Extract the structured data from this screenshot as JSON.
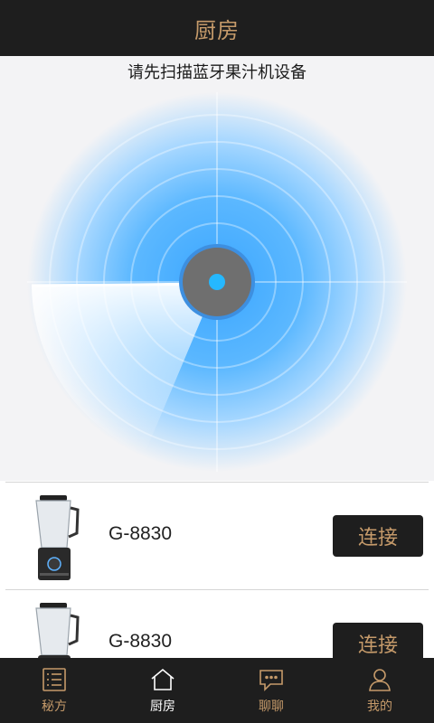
{
  "header": {
    "title": "厨房"
  },
  "scan": {
    "hint": "请先扫描蓝牙果汁机设备"
  },
  "devices": [
    {
      "model": "G-8830",
      "action_label": "连接"
    },
    {
      "model": "G-8830",
      "action_label": "连接"
    }
  ],
  "tabbar": {
    "items": [
      {
        "label": "秘方",
        "icon": "recipe-list-icon",
        "active": false
      },
      {
        "label": "厨房",
        "icon": "kitchen-house-icon",
        "active": true
      },
      {
        "label": "聊聊",
        "icon": "chat-bubble-icon",
        "active": false
      },
      {
        "label": "我的",
        "icon": "user-profile-icon",
        "active": false
      }
    ]
  },
  "colors": {
    "bar_background": "#1e1e1e",
    "accent_gold": "#c59a6a",
    "radar_blue": "#3aa6ff",
    "center_dot": "#25b8ff"
  }
}
